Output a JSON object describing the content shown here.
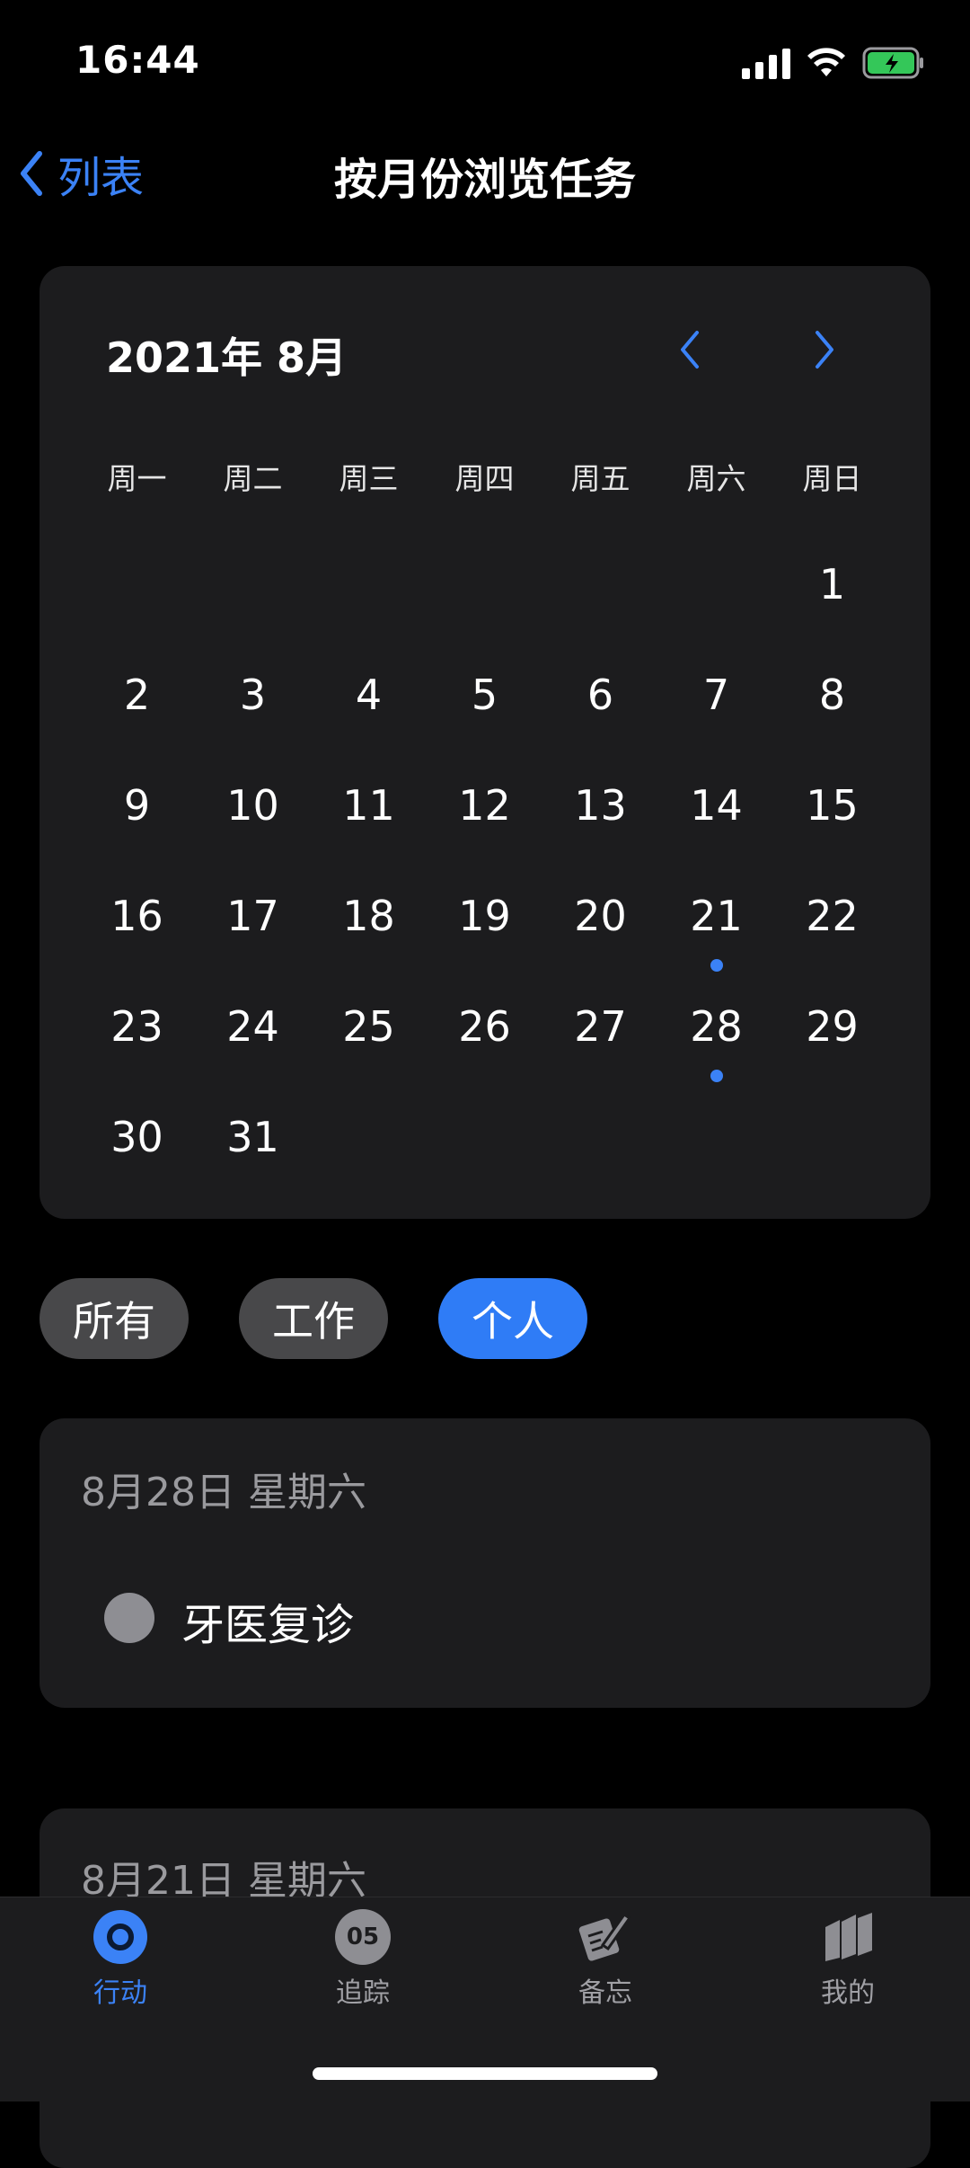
{
  "status": {
    "time": "16:44"
  },
  "nav": {
    "back_label": "列表",
    "title": "按月份浏览任务"
  },
  "calendar": {
    "month_title": "2021年 8月",
    "weekdays": [
      "周一",
      "周二",
      "周三",
      "周四",
      "周五",
      "周六",
      "周日"
    ],
    "days": [
      "",
      "",
      "",
      "",
      "",
      "",
      "1",
      "2",
      "3",
      "4",
      "5",
      "6",
      "7",
      "8",
      "9",
      "10",
      "11",
      "12",
      "13",
      "14",
      "15",
      "16",
      "17",
      "18",
      "19",
      "20",
      "21",
      "22",
      "23",
      "24",
      "25",
      "26",
      "27",
      "28",
      "29",
      "30",
      "31",
      "",
      "",
      "",
      "",
      ""
    ],
    "task_marker_days": [
      "21",
      "28"
    ],
    "accent_color": "#3b82f6"
  },
  "filters": [
    {
      "label": "所有",
      "active": false
    },
    {
      "label": "工作",
      "active": false
    },
    {
      "label": "个人",
      "active": true
    }
  ],
  "task_groups": [
    {
      "date": "8月28日 星期六",
      "tasks": [
        "牙医复诊"
      ]
    },
    {
      "date": "8月21日 星期六",
      "tasks": []
    }
  ],
  "tabbar": {
    "items": [
      {
        "label": "行动",
        "icon": "target-icon",
        "active": true
      },
      {
        "label": "追踪",
        "icon": "day-counter-icon",
        "badge": "05",
        "active": false
      },
      {
        "label": "备忘",
        "icon": "memo-pen-icon",
        "active": false
      },
      {
        "label": "我的",
        "icon": "books-icon",
        "active": false
      }
    ]
  }
}
